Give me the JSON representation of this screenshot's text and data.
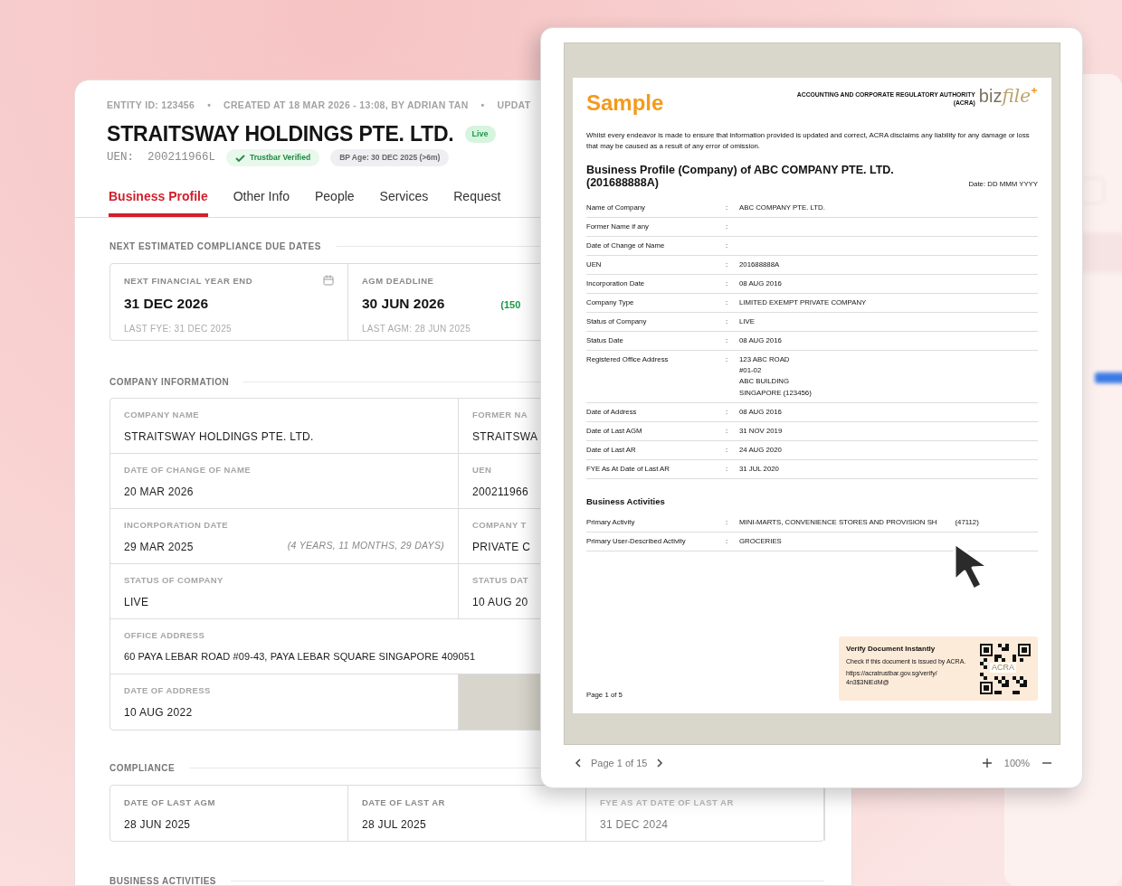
{
  "entity_meta": {
    "separator": "•",
    "items": [
      "ENTITY ID: 123456",
      "CREATED AT 18 MAR 2026 - 13:08, BY ADRIAN TAN",
      "UPDAT"
    ]
  },
  "company": {
    "name": "STRAITSWAY HOLDINGS PTE. LTD.",
    "status_badge": "Live",
    "uen_label": "UEN:",
    "uen": "200211966L",
    "verified_badge": "Trustbar Verified",
    "bp_age": "BP Age: 30 DEC 2025 (>6m)"
  },
  "tabs": [
    {
      "label": "Business Profile",
      "selected": true
    },
    {
      "label": "Other Info",
      "selected": false
    },
    {
      "label": "People",
      "selected": false
    },
    {
      "label": "Services",
      "selected": false
    },
    {
      "label": "Request",
      "selected": false
    }
  ],
  "due_dates": {
    "title": "NEXT ESTIMATED COMPLIANCE DUE DATES",
    "cards": [
      {
        "label": "NEXT FINANCIAL YEAR END",
        "value": "31 DEC 2026",
        "sub": "LAST FYE: 31 DEC 2025",
        "icon": true
      },
      {
        "label": "AGM DEADLINE",
        "value": "30 JUN 2026",
        "note": "(150",
        "sub": "LAST AGM: 28 JUN 2025",
        "icon": false
      }
    ]
  },
  "company_info": {
    "title": "COMPANY INFORMATION",
    "rows": [
      {
        "cells": [
          {
            "kind": "field",
            "label": "COMPANY NAME",
            "value": "STRAITSWAY HOLDINGS PTE. LTD."
          },
          {
            "kind": "field",
            "label": "FORMER NA",
            "value": "STRAITSWA"
          }
        ]
      },
      {
        "cells": [
          {
            "kind": "field",
            "label": "DATE OF CHANGE OF NAME",
            "value": "20 MAR 2026"
          },
          {
            "kind": "field",
            "label": "UEN",
            "value": "200211966"
          }
        ]
      },
      {
        "cells": [
          {
            "kind": "field",
            "label": "INCORPORATION DATE",
            "value": "29 MAR 2025",
            "note": "(4 YEARS, 11 MONTHS, 29 DAYS)"
          },
          {
            "kind": "field",
            "label": "COMPANY T",
            "value": "PRIVATE C"
          }
        ]
      },
      {
        "cells": [
          {
            "kind": "field",
            "label": "STATUS OF COMPANY",
            "value": "LIVE"
          },
          {
            "kind": "field",
            "label": "STATUS DAT",
            "value": "10 AUG 20"
          }
        ]
      },
      {
        "cells": [
          {
            "kind": "wide",
            "label": "OFFICE ADDRESS",
            "value": "60 PAYA LEBAR ROAD #09-43, PAYA LEBAR SQUARE SINGAPORE 409051"
          }
        ]
      },
      {
        "cells": [
          {
            "kind": "field",
            "label": "DATE OF ADDRESS",
            "value": "10 AUG 2022"
          },
          {
            "kind": "empty"
          }
        ]
      }
    ]
  },
  "compliance": {
    "title": "COMPLIANCE",
    "cells": [
      {
        "label": "DATE OF LAST AGM",
        "value": "28 JUN 2025",
        "faded": false
      },
      {
        "label": "DATE OF LAST AR",
        "value": "28 JUL 2025",
        "faded": false
      },
      {
        "label": "FYE AS AT DATE OF LAST AR",
        "value": "31 DEC 2024",
        "faded": true
      }
    ]
  },
  "business_activities": {
    "title": "BUSINESS ACTIVITIES"
  },
  "document": {
    "sample_label": "Sample",
    "authority": [
      "ACCOUNTING AND CORPORATE REGULATORY AUTHORITY",
      "(ACRA)"
    ],
    "logo_parts": [
      "biz",
      "file"
    ],
    "disclaimer": "Whilst every endeavor is made to ensure that information provided is updated and correct, ACRA disclaims any liability for any damage or loss that may be caused as a result of any error of omission.",
    "title": "Business Profile (Company) of ABC COMPANY PTE. LTD. (201688888A)",
    "date": "Date: DD MMM YYYY",
    "colon": ":",
    "rows": [
      {
        "label": "Name of Company",
        "lines": [
          "ABC COMPANY PTE. LTD."
        ]
      },
      {
        "label": "Former Name if any",
        "lines": []
      },
      {
        "label": "Date of Change of Name",
        "lines": []
      },
      {
        "label": "UEN",
        "lines": [
          "201688888A"
        ]
      },
      {
        "label": "Incorporation Date",
        "lines": [
          "08 AUG 2016"
        ]
      },
      {
        "label": "Company Type",
        "lines": [
          "LIMITED EXEMPT PRIVATE COMPANY"
        ]
      },
      {
        "label": "Status of Company",
        "lines": [
          "LIVE"
        ]
      },
      {
        "label": "Status Date",
        "lines": [
          "08 AUG 2016"
        ]
      },
      {
        "label": "Registered Office Address",
        "lines": [
          "123 ABC ROAD",
          "#01-02",
          "ABC BUILDING",
          "SINGAPORE (123456)"
        ]
      },
      {
        "label": "Date of Address",
        "lines": [
          "08 AUG 2016"
        ]
      },
      {
        "label": "Date of Last AGM",
        "lines": [
          "31 NOV 2019"
        ]
      },
      {
        "label": "Date of Last AR",
        "lines": [
          "24 AUG 2020"
        ]
      },
      {
        "label": "FYE As At Date of Last AR",
        "lines": [
          "31 JUL 2020"
        ]
      }
    ],
    "activities_title": "Business Activities",
    "activity_rows": [
      {
        "label": "Primary Activity",
        "lines": [
          "MINI-MARTS, CONVENIENCE STORES AND PROVISION SH"
        ],
        "tail": "(47112)"
      },
      {
        "label": "Primary User-Described Activity",
        "lines": [
          "GROCERIES"
        ]
      }
    ],
    "verify": {
      "title": "Verify Document Instantly",
      "text": "Check if this document is issued by ACRA.",
      "url": "https://acratrustbar.gov.sg/verify/ 4n3$3NlEdM@",
      "qr_label": "ACRA"
    },
    "page_label": "Page 1 of 5"
  },
  "toolbar": {
    "page": "Page 1 of 15",
    "zoom": "100%"
  }
}
